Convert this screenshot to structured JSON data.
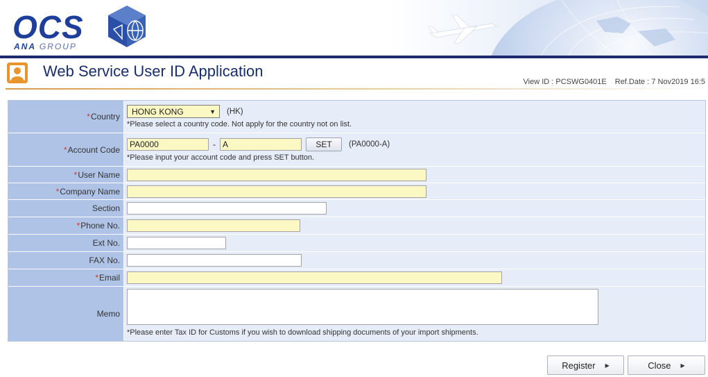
{
  "brand": {
    "logo_text": "OCS",
    "logo_sub_ana": "ANA",
    "logo_sub_group": "GROUP"
  },
  "header": {
    "title": "Web Service User ID Application",
    "view_id": "View ID : PCSWG0401E",
    "ref_date": "Ref.Date : 7 Nov2019 16:5"
  },
  "form": {
    "required_mark": "*",
    "country": {
      "label": "Country",
      "value": "HONG KONG",
      "code": "(HK)",
      "note": "*Please select a country code. Not apply for the country not on list."
    },
    "account_code": {
      "label": "Account Code",
      "value_main": "PA0000",
      "separator": "-",
      "value_suffix": "A",
      "set_label": "SET",
      "example": "(PA0000-A)",
      "note": "*Please input your account code and press SET button."
    },
    "user_name": {
      "label": "User Name",
      "value": ""
    },
    "company_name": {
      "label": "Company Name",
      "value": ""
    },
    "section": {
      "label": "Section",
      "value": ""
    },
    "phone_no": {
      "label": "Phone No.",
      "value": ""
    },
    "ext_no": {
      "label": "Ext No.",
      "value": ""
    },
    "fax_no": {
      "label": "FAX No.",
      "value": ""
    },
    "email": {
      "label": "Email",
      "value": ""
    },
    "memo": {
      "label": "Memo",
      "value": "",
      "note": "*Please enter Tax ID for Customs if you wish to download shipping documents of your import shipments."
    }
  },
  "actions": {
    "register_label": "Register",
    "close_label": "Close"
  },
  "colors": {
    "brand_blue": "#1e3f99",
    "label_bg": "#afc3e7",
    "value_bg": "#e6ecf8",
    "required_field_bg": "#fcf8c4",
    "required_mark": "#e0302a"
  }
}
